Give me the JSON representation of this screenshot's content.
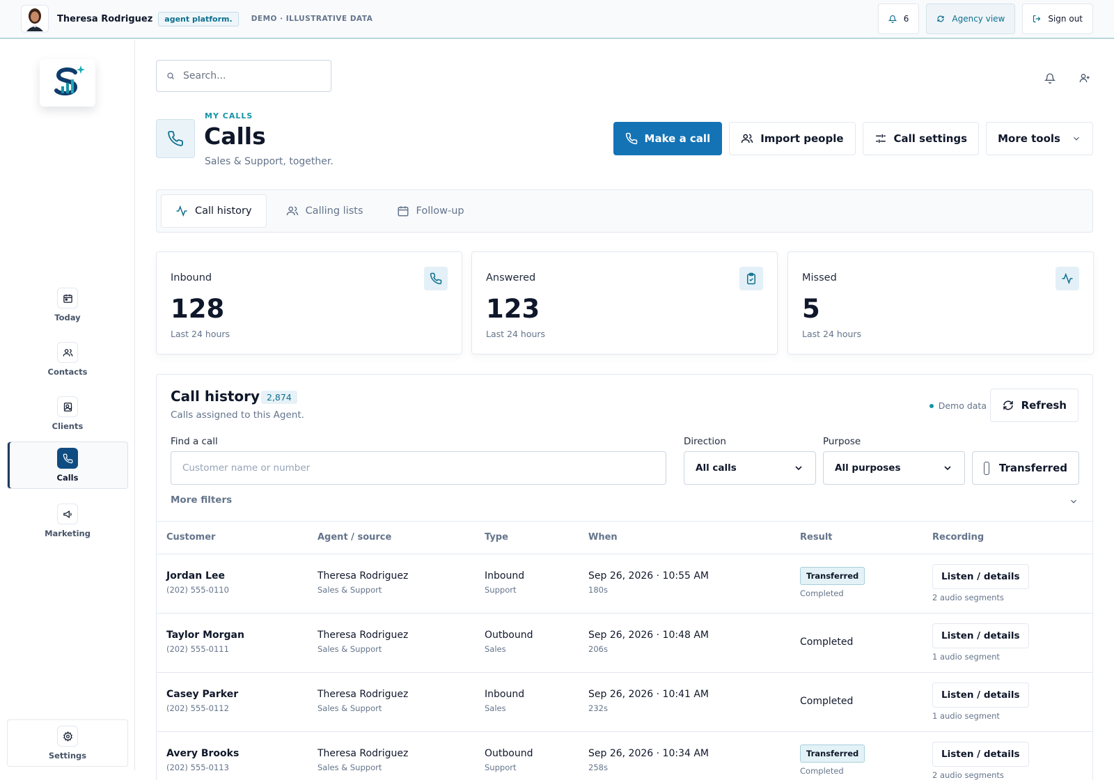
{
  "topbar": {
    "user_name": "Theresa Rodriguez",
    "brand": "agent platform.",
    "demo_tag": "DEMO · ILLUSTRATIVE DATA",
    "notifications_count": "6",
    "agency_view": "Agency view",
    "sign_out": "Sign out"
  },
  "sidebar": {
    "items": [
      {
        "label": "Today",
        "icon": "calendar-icon"
      },
      {
        "label": "Contacts",
        "icon": "users-icon"
      },
      {
        "label": "Clients",
        "icon": "client-card-icon"
      },
      {
        "label": "Calls",
        "icon": "phone-icon"
      },
      {
        "label": "Marketing",
        "icon": "megaphone-icon"
      }
    ],
    "settings_label": "Settings",
    "active": "Calls"
  },
  "search": {
    "placeholder": "Search..."
  },
  "header": {
    "eyebrow": "MY CALLS",
    "title": "Calls",
    "subtitle": "Sales & Support, together."
  },
  "actions": {
    "make_call": "Make a call",
    "import_people": "Import people",
    "call_settings": "Call settings",
    "more_tools": "More tools"
  },
  "tabs": [
    {
      "label": "Call history",
      "icon": "activity-icon",
      "active": true
    },
    {
      "label": "Calling lists",
      "icon": "users-icon",
      "active": false
    },
    {
      "label": "Follow-up",
      "icon": "calendar-icon",
      "active": false
    }
  ],
  "stats": [
    {
      "label": "Inbound",
      "value": "128",
      "period": "Last 24 hours",
      "icon": "phone-icon"
    },
    {
      "label": "Answered",
      "value": "123",
      "period": "Last 24 hours",
      "icon": "clipboard-check-icon"
    },
    {
      "label": "Missed",
      "value": "5",
      "period": "Last 24 hours",
      "icon": "activity-icon"
    }
  ],
  "history": {
    "title": "Call history",
    "count": "2,874",
    "subtitle": "Calls assigned to this Agent.",
    "demo_data": "Demo data",
    "refresh": "Refresh",
    "filters": {
      "find_label": "Find a call",
      "find_placeholder": "Customer name or number",
      "direction_label": "Direction",
      "direction_value": "All calls",
      "purpose_label": "Purpose",
      "purpose_value": "All purposes",
      "transferred_label": "Transferred",
      "more_filters": "More filters"
    },
    "columns": [
      "Customer",
      "Agent / source",
      "Type",
      "When",
      "Result",
      "Recording"
    ],
    "rows": [
      {
        "customer": "Jordan Lee",
        "phone": "(202) 555-0110",
        "agent": "Theresa Rodriguez",
        "source": "Sales & Support",
        "type": "Inbound",
        "purpose": "Support",
        "when": "Sep 26, 2026 · 10:55 AM",
        "duration": "180s",
        "badge": "Transferred",
        "result": "Completed",
        "listen": "Listen / details",
        "segments": "2 audio segments"
      },
      {
        "customer": "Taylor Morgan",
        "phone": "(202) 555-0111",
        "agent": "Theresa Rodriguez",
        "source": "Sales & Support",
        "type": "Outbound",
        "purpose": "Sales",
        "when": "Sep 26, 2026 · 10:48 AM",
        "duration": "206s",
        "badge": "",
        "result": "Completed",
        "listen": "Listen / details",
        "segments": "1 audio segment"
      },
      {
        "customer": "Casey Parker",
        "phone": "(202) 555-0112",
        "agent": "Theresa Rodriguez",
        "source": "Sales & Support",
        "type": "Inbound",
        "purpose": "Sales",
        "when": "Sep 26, 2026 · 10:41 AM",
        "duration": "232s",
        "badge": "",
        "result": "Completed",
        "listen": "Listen / details",
        "segments": "1 audio segment"
      },
      {
        "customer": "Avery Brooks",
        "phone": "(202) 555-0113",
        "agent": "Theresa Rodriguez",
        "source": "Sales & Support",
        "type": "Outbound",
        "purpose": "Support",
        "when": "Sep 26, 2026 · 10:34 AM",
        "duration": "258s",
        "badge": "Transferred",
        "result": "Completed",
        "listen": "Listen / details",
        "segments": "2 audio segments"
      }
    ]
  },
  "colors": {
    "accent": "#1473b5",
    "teal": "#1593a7",
    "navy": "#0f4c81"
  }
}
